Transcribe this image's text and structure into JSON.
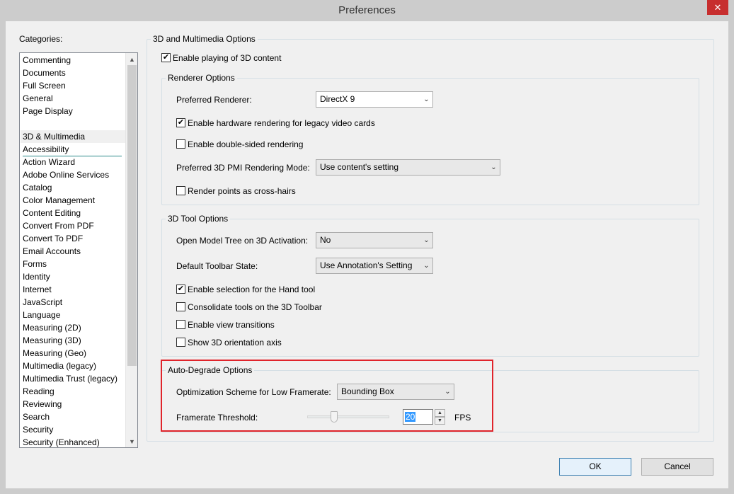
{
  "window": {
    "title": "Preferences",
    "close_glyph": "✕"
  },
  "categories": {
    "label": "Categories:",
    "group1": [
      "Commenting",
      "Documents",
      "Full Screen",
      "General",
      "Page Display"
    ],
    "group2": [
      "3D & Multimedia",
      "Accessibility",
      "Action Wizard",
      "Adobe Online Services",
      "Catalog",
      "Color Management",
      "Content Editing",
      "Convert From PDF",
      "Convert To PDF",
      "Email Accounts",
      "Forms",
      "Identity",
      "Internet",
      "JavaScript",
      "Language",
      "Measuring (2D)",
      "Measuring (3D)",
      "Measuring (Geo)",
      "Multimedia (legacy)",
      "Multimedia Trust (legacy)",
      "Reading",
      "Reviewing",
      "Search",
      "Security",
      "Security (Enhanced)"
    ],
    "selected": "3D & Multimedia",
    "scroll_up_glyph": "▲",
    "scroll_down_glyph": "▼"
  },
  "main": {
    "section_title": "3D and Multimedia Options",
    "enable_3d": {
      "label": "Enable playing of 3D content",
      "checked": true
    },
    "renderer": {
      "title": "Renderer Options",
      "preferred_renderer_label": "Preferred Renderer:",
      "preferred_renderer_value": "DirectX 9",
      "hw_rendering": {
        "label": "Enable hardware rendering for legacy video cards",
        "checked": true
      },
      "double_sided": {
        "label": "Enable double-sided rendering",
        "checked": false
      },
      "pmi_label": "Preferred 3D PMI Rendering Mode:",
      "pmi_value": "Use content's setting",
      "crosshairs": {
        "label": "Render points as cross-hairs",
        "checked": false
      }
    },
    "tool": {
      "title": "3D Tool Options",
      "model_tree_label": "Open Model Tree on 3D Activation:",
      "model_tree_value": "No",
      "toolbar_state_label": "Default Toolbar State:",
      "toolbar_state_value": "Use Annotation's Setting",
      "hand_tool": {
        "label": "Enable selection for the Hand tool",
        "checked": true
      },
      "consolidate": {
        "label": "Consolidate tools on the 3D Toolbar",
        "checked": false
      },
      "view_transitions": {
        "label": "Enable view transitions",
        "checked": false
      },
      "orientation_axis": {
        "label": "Show 3D orientation axis",
        "checked": false
      }
    },
    "degrade": {
      "title": "Auto-Degrade Options",
      "scheme_label": "Optimization Scheme for Low Framerate:",
      "scheme_value": "Bounding Box",
      "threshold_label": "Framerate Threshold:",
      "threshold_value": "20",
      "threshold_unit": "FPS"
    }
  },
  "buttons": {
    "ok": "OK",
    "cancel": "Cancel"
  },
  "icons": {
    "check_glyph": "✔",
    "combo_arrow": "⌄",
    "spin_up": "▲",
    "spin_down": "▼"
  },
  "colors": {
    "highlight": "#e0242b",
    "selection": "#3399ff",
    "close": "#c72e2e"
  }
}
